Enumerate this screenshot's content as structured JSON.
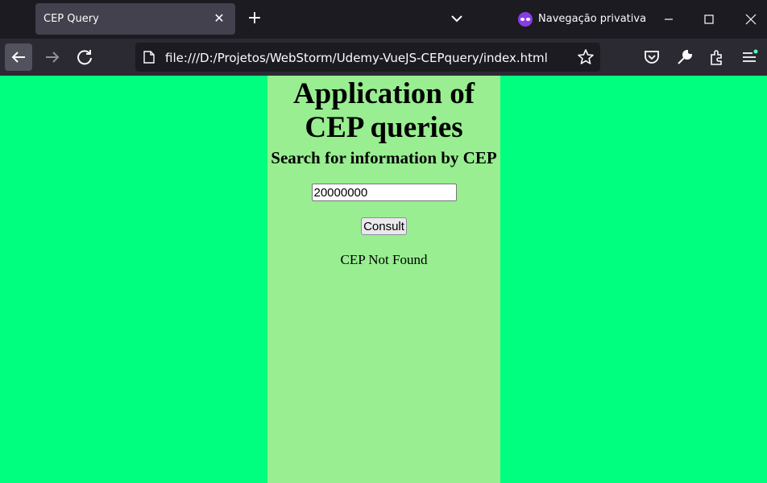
{
  "browser": {
    "tab_title": "CEP Query",
    "private_label": "Navegação privativa",
    "url": "file:///D:/Projetos/WebStorm/Udemy-VueJS-CEPquery/index.html"
  },
  "page": {
    "title": "Application of CEP queries",
    "subtitle": "Search for information by CEP",
    "cep_value": "20000000",
    "consult_label": "Consult",
    "result_text": "CEP Not Found"
  },
  "colors": {
    "page_background": "#00ff7f",
    "container_background": "#98ee90"
  }
}
